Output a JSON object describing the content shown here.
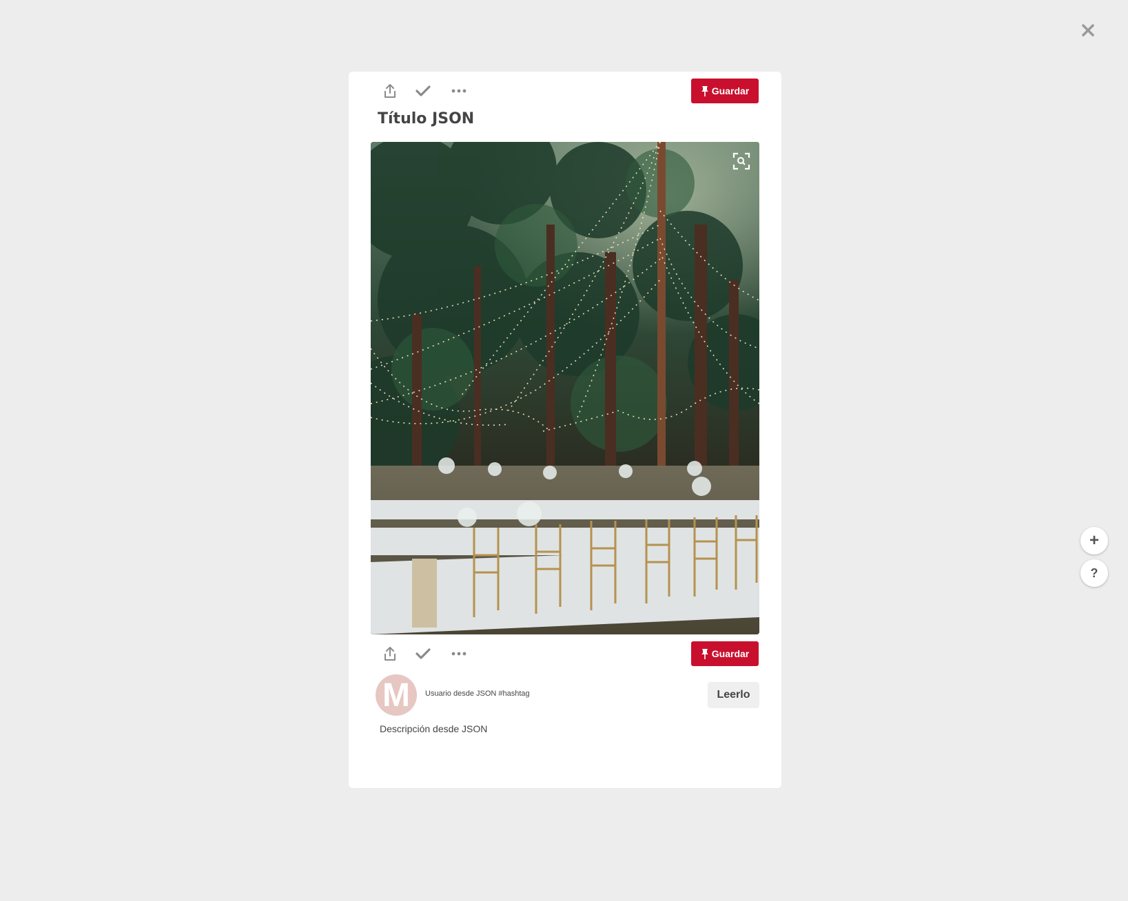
{
  "modal": {
    "close_icon": "close-icon",
    "side_actions": {
      "add_label": "+",
      "help_label": "?"
    }
  },
  "pin": {
    "title": "Título JSON",
    "description": "Descripción desde JSON",
    "image_alt": "forest wedding reception with string lights",
    "toolbar": {
      "share_icon": "share-icon",
      "done_icon": "check-icon",
      "more_icon": "more-icon",
      "save_label": "Guardar"
    },
    "author": {
      "avatar_letter": "M",
      "text": "Usuario desde JSON #hashtag"
    },
    "read_button_label": "Leerlo"
  },
  "colors": {
    "save_button": "#c8102e",
    "background": "#ededed",
    "avatar": "#e6c7c1"
  }
}
